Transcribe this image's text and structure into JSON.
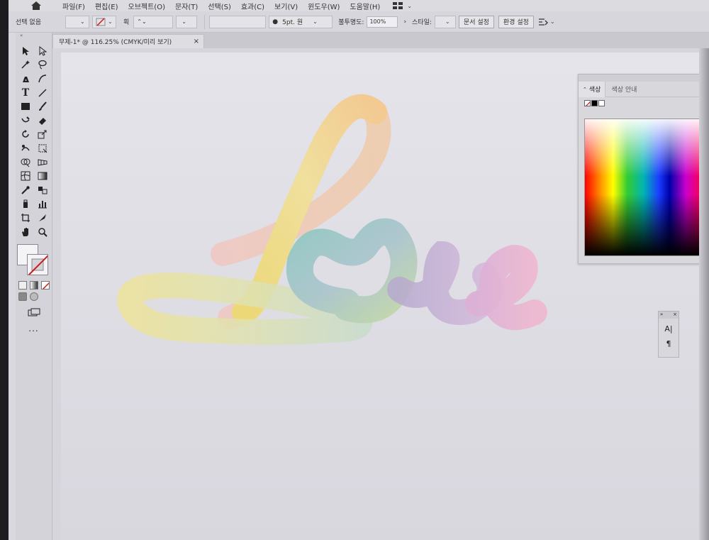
{
  "menu": {
    "items": [
      "파일(F)",
      "편집(E)",
      "오브젝트(O)",
      "문자(T)",
      "선택(S)",
      "효과(C)",
      "보기(V)",
      "윈도우(W)",
      "도움말(H)"
    ]
  },
  "controlbar": {
    "selection_label": "선택 없음",
    "stroke_label": "획",
    "stroke_weight": "5pt. 원",
    "opacity_label": "불투명도:",
    "opacity_value": "100%",
    "style_label": "스타일:",
    "doc_setup_button": "문서 설정",
    "preferences_button": "환경 설정"
  },
  "document": {
    "tab_title": "무제-1* @ 116.25% (CMYK/미리 보기)",
    "close_label": "×"
  },
  "toolbar": {
    "more_label": "..."
  },
  "color_panel": {
    "tab_color": "색상",
    "tab_color_guide": "색상 안내"
  },
  "mini_panel": {
    "char_label": "A|",
    "para_label": "¶"
  },
  "colors": {
    "ui_bg": "#d7d6dc",
    "artboard": "#e2e1e7",
    "lettering_gradient": [
      "#f3d08f",
      "#f0e07a",
      "#a9d2c5",
      "#b7a9d8",
      "#ecb5d3"
    ]
  },
  "icons": [
    "home-icon",
    "workspace-switcher-icon",
    "selection-tool-icon",
    "direct-selection-tool-icon",
    "magic-wand-icon",
    "lasso-icon",
    "pen-icon",
    "curvature-icon",
    "type-icon",
    "line-icon",
    "rectangle-icon",
    "paintbrush-icon",
    "shaper-icon",
    "eraser-icon",
    "rotate-icon",
    "scale-icon",
    "warp-icon",
    "free-transform-icon",
    "shape-builder-icon",
    "perspective-grid-icon",
    "mesh-icon",
    "gradient-icon",
    "eyedropper-icon",
    "blend-icon",
    "symbol-sprayer-icon",
    "graph-icon",
    "artboard-tool-icon",
    "slice-icon",
    "hand-icon",
    "zoom-icon",
    "arrange-documents-icon"
  ]
}
